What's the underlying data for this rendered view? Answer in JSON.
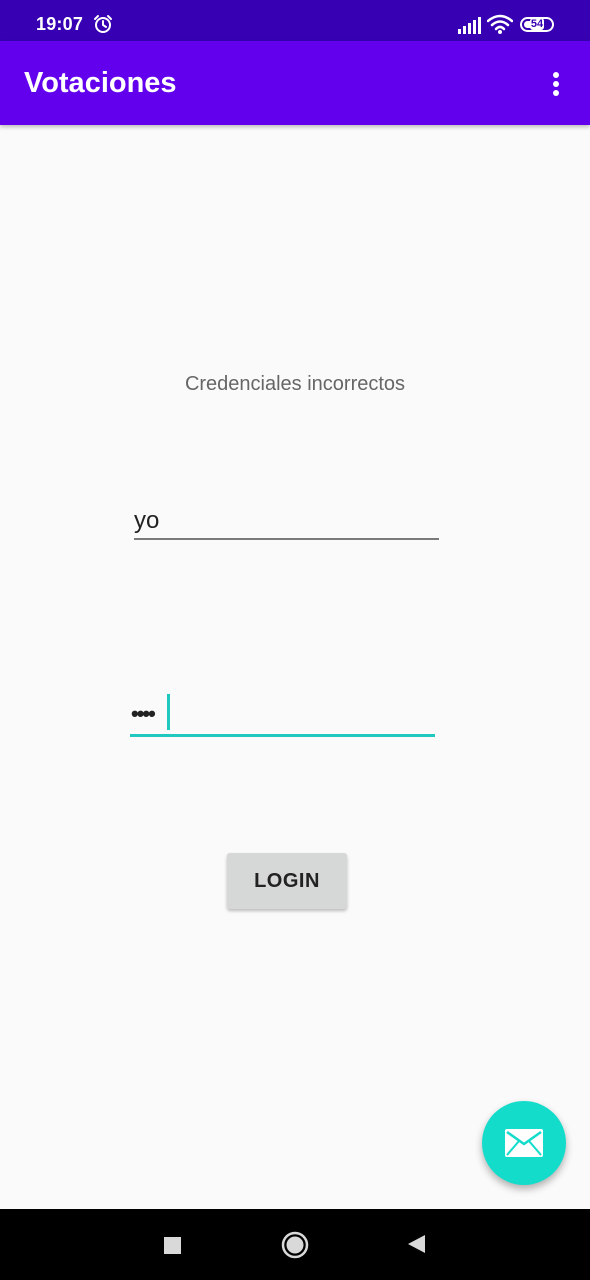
{
  "status_bar": {
    "time": "19:07",
    "battery_level": "54",
    "icons": [
      "alarm-icon",
      "signal-icon",
      "wifi-icon",
      "battery-icon"
    ]
  },
  "app_bar": {
    "title": "Votaciones",
    "menu_icon": "overflow-menu-icon",
    "color": "#6200ee"
  },
  "login_form": {
    "message": "Credenciales incorrectos",
    "username": {
      "value": "yo"
    },
    "password": {
      "value": "••••",
      "accent_color": "#20c9c0"
    },
    "login_button": "LOGIN"
  },
  "fab": {
    "icon": "mail-icon",
    "color": "#13dccb"
  },
  "nav_bar": {
    "icons": [
      "recents-icon",
      "home-icon",
      "back-icon"
    ]
  }
}
